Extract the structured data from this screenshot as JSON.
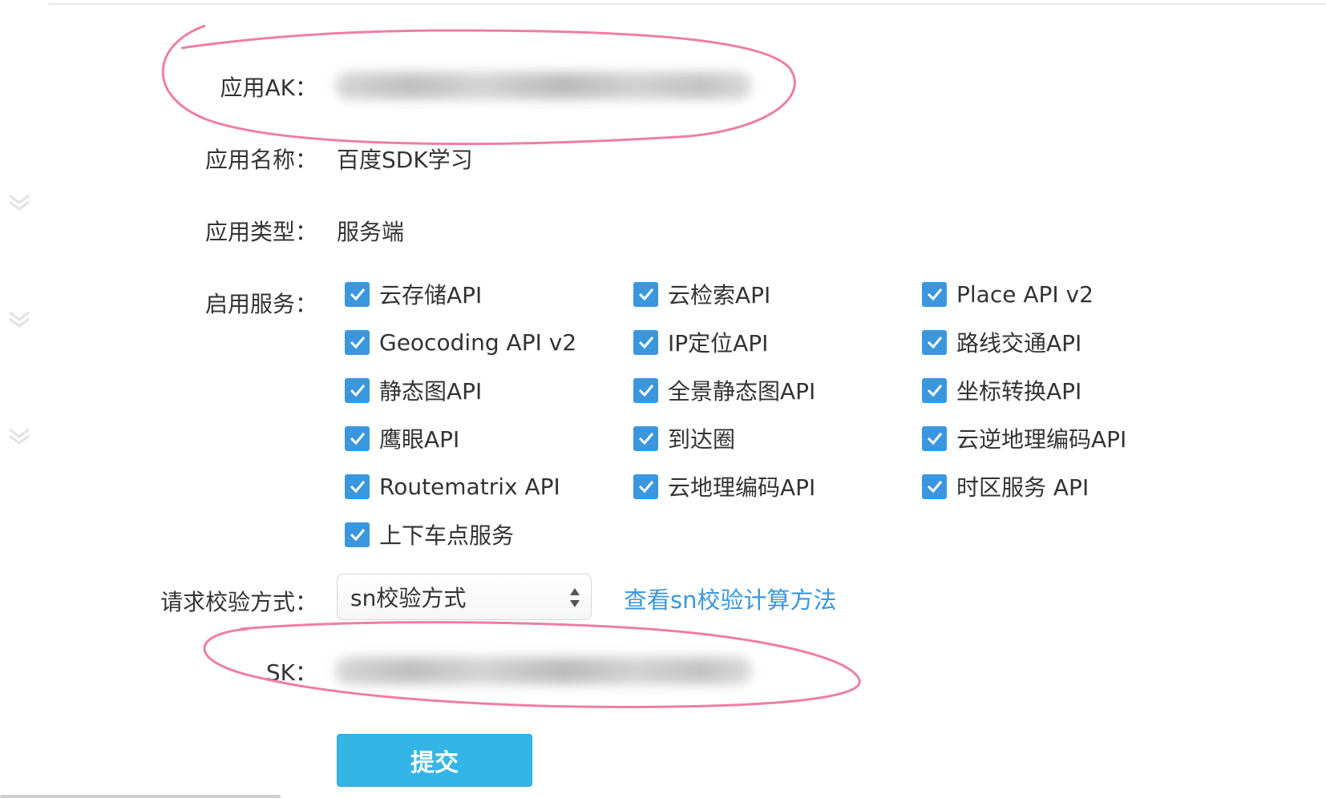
{
  "form": {
    "ak_label": "应用AK：",
    "name_label": "应用名称：",
    "name_value": "百度SDK学习",
    "type_label": "应用类型：",
    "type_value": "服务端",
    "services_label": "启用服务：",
    "services": [
      {
        "label": "云存储API",
        "checked": true
      },
      {
        "label": "云检索API",
        "checked": true
      },
      {
        "label": "Place API v2",
        "checked": true
      },
      {
        "label": "Geocoding API v2",
        "checked": true
      },
      {
        "label": "IP定位API",
        "checked": true
      },
      {
        "label": "路线交通API",
        "checked": true
      },
      {
        "label": "静态图API",
        "checked": true
      },
      {
        "label": "全景静态图API",
        "checked": true
      },
      {
        "label": "坐标转换API",
        "checked": true
      },
      {
        "label": "鹰眼API",
        "checked": true
      },
      {
        "label": "到达圈",
        "checked": true
      },
      {
        "label": "云逆地理编码API",
        "checked": true
      },
      {
        "label": "Routematrix API",
        "checked": true
      },
      {
        "label": "云地理编码API",
        "checked": true
      },
      {
        "label": "时区服务 API",
        "checked": true
      },
      {
        "label": "上下车点服务",
        "checked": true
      }
    ],
    "verify_label": "请求校验方式：",
    "verify_selected": "sn校验方式",
    "verify_help_link": "查看sn校验计算方法",
    "sk_label": "SK：",
    "submit_label": "提交"
  },
  "icons": {
    "checkbox": "checkmark-icon",
    "select": "select-updown-arrows-icon",
    "side": "chevron-down-icon"
  },
  "colors": {
    "checkbox": "#3b97dd",
    "link": "#3a96dd",
    "submit": "#33b5e5",
    "annotation": "#ee7ea4"
  }
}
